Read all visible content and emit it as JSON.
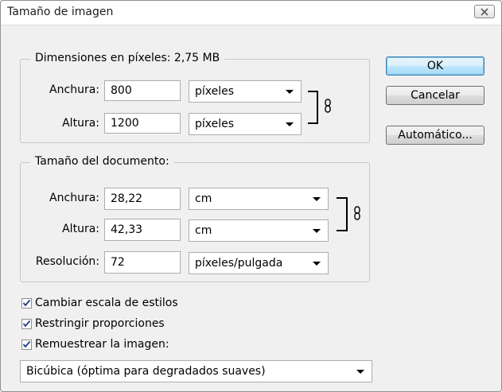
{
  "window": {
    "title": "Tamaño de imagen"
  },
  "pixel_dimensions": {
    "legend": "Dimensiones en píxeles:",
    "size": "2,75 MB",
    "width_label": "Anchura:",
    "width_value": "800",
    "width_unit": "píxeles",
    "height_label": "Altura:",
    "height_value": "1200",
    "height_unit": "píxeles",
    "link_icon": "chain-link-icon"
  },
  "document_size": {
    "legend": "Tamaño del documento:",
    "width_label": "Anchura:",
    "width_value": "28,22",
    "width_unit": "cm",
    "height_label": "Altura:",
    "height_value": "42,33",
    "height_unit": "cm",
    "resolution_label": "Resolución:",
    "resolution_value": "72",
    "resolution_unit": "píxeles/pulgada",
    "link_icon": "chain-link-icon"
  },
  "options": {
    "scale_styles": {
      "label": "Cambiar escala de estilos",
      "checked": true
    },
    "constrain": {
      "label": "Restringir proporciones",
      "checked": true
    },
    "resample": {
      "label": "Remuestrear la imagen:",
      "checked": true
    },
    "resample_method": "Bicúbica (óptima para degradados suaves)"
  },
  "buttons": {
    "ok": "OK",
    "cancel": "Cancelar",
    "auto": "Automático..."
  },
  "colors": {
    "dialog_bg": "#f0f0f0",
    "default_button": "#bee6fd"
  }
}
